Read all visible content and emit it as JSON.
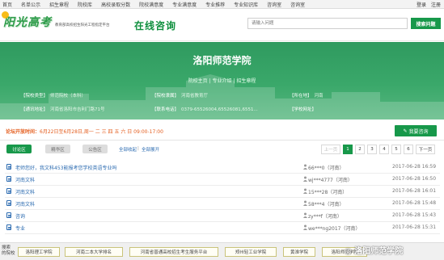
{
  "topnav": {
    "items": [
      "首页",
      "名单公示",
      "招生章程",
      "院校库",
      "高校录取分数",
      "院校满意度",
      "专业满意度",
      "专业推荐",
      "专业知识库",
      "咨询室",
      "咨询室"
    ],
    "right": [
      "登录",
      "注册"
    ]
  },
  "header": {
    "logo_text": "阳光高考",
    "logo_sub": "教育部高校招生阳光工程指定平台",
    "page_title": "在线咨询",
    "search_placeholder": "请输入问题",
    "search_button": "搜索问题"
  },
  "banner": {
    "school_name": "洛阳师范学院",
    "links": "院校主页 | 专业介绍 | 招生章程",
    "info": [
      {
        "label": "【院校类型】",
        "value": "师范院校（本科）"
      },
      {
        "label": "【院校隶属】",
        "value": "河南省教育厅"
      },
      {
        "label": "【所在地】",
        "value": "河南"
      },
      {
        "label": "【通讯地址】",
        "value": "河南省洛阳市吉利门路71号"
      },
      {
        "label": "【联系电话】",
        "value": "0379-65526004,65526081,6551..."
      },
      {
        "label": "【学校网址】",
        "value": ""
      }
    ]
  },
  "timebar": {
    "label": "论坛开放时间：",
    "value": "6月22日至6月28日,周一 二 三 四 五 六 日 09:00-17:00",
    "ask_button": "我要咨询"
  },
  "tabs": {
    "items": [
      "讨论区",
      "精华区",
      "公告区"
    ],
    "links": [
      "全部收起",
      "全部展开"
    ]
  },
  "pager": {
    "prev": "上一页",
    "pages": [
      "1",
      "2",
      "3",
      "4",
      "5",
      "6"
    ],
    "current": "1",
    "next": "下一页"
  },
  "questions": [
    {
      "q": "老师您好，我文科453能报考您学校英语专业吗",
      "user": "66***0（河南）",
      "date": "2017-06-28 16:59"
    },
    {
      "q": "河南文科",
      "user": "wj***4777（河南）",
      "date": "2017-06-28 16:50"
    },
    {
      "q": "河南文科",
      "user": "15***28（河南）",
      "date": "2017-06-28 16:01"
    },
    {
      "q": "河南文科",
      "user": "58***4（河南）",
      "date": "2017-06-28 15:48"
    },
    {
      "q": "咨询",
      "user": "zy***f（河南）",
      "date": "2017-06-28 15:43"
    },
    {
      "q": "专业",
      "user": "we***ng2017（河南）",
      "date": "2017-06-28 15:31"
    }
  ],
  "footer": {
    "label": "搜索\n的院校",
    "schools": [
      "洛阳理工学院",
      "河南二本大学排名",
      "河南省普通高校招生考生服务平台",
      "郑州轻工业学院",
      "黄淮学院",
      "洛阳师范学院"
    ]
  },
  "watermark": "洛阳师范学院",
  "colors": {
    "brand_green": "#17984a",
    "banner": "#3aa86a",
    "link": "#2a6ab0",
    "orange": "#e45d1d"
  }
}
